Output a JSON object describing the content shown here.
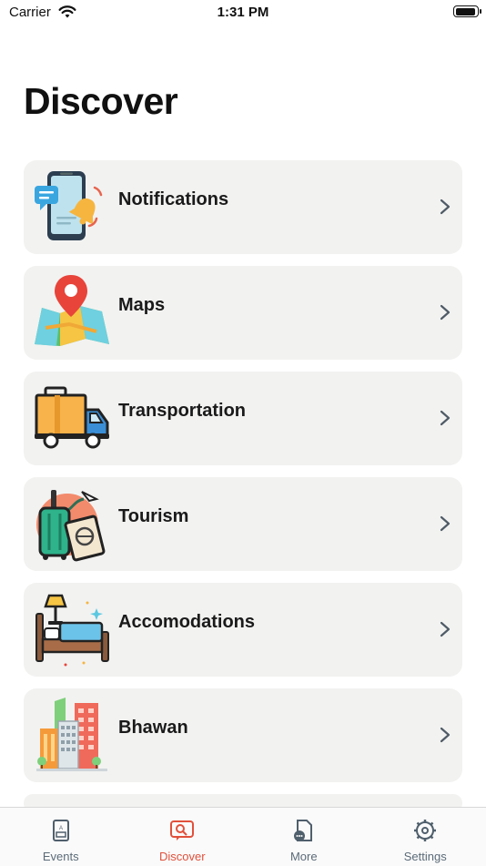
{
  "status_bar": {
    "carrier": "Carrier",
    "time": "1:31 PM",
    "battery_level": 0.95
  },
  "page": {
    "title": "Discover"
  },
  "items": [
    {
      "label": "Notifications",
      "icon": "phone-bell-icon"
    },
    {
      "label": "Maps",
      "icon": "map-pin-icon"
    },
    {
      "label": "Transportation",
      "icon": "truck-icon"
    },
    {
      "label": "Tourism",
      "icon": "luggage-passport-icon"
    },
    {
      "label": "Accomodations",
      "icon": "bed-lamp-icon"
    },
    {
      "label": "Bhawan",
      "icon": "buildings-icon"
    }
  ],
  "tabbar": {
    "tabs": [
      {
        "label": "Events",
        "icon": "events-icon",
        "active": false
      },
      {
        "label": "Discover",
        "icon": "discover-icon",
        "active": true
      },
      {
        "label": "More",
        "icon": "more-icon",
        "active": false
      },
      {
        "label": "Settings",
        "icon": "settings-gear-icon",
        "active": false
      }
    ]
  },
  "colors": {
    "active_tab": "#e1503b",
    "inactive_tab": "#5b6b78",
    "card_bg": "#f2f2f1"
  }
}
